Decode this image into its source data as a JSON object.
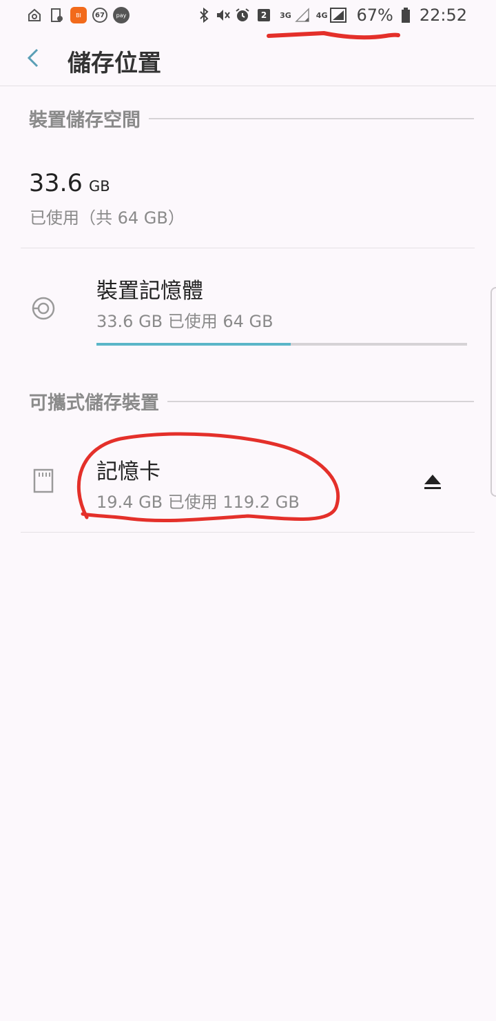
{
  "status_bar": {
    "notif_badge": "BI",
    "circle_num": "67",
    "pay_label": "pay",
    "notif_count": "2",
    "net_3g": "3G",
    "net_4g": "4G",
    "battery": "67%",
    "time": "22:52"
  },
  "header": {
    "title": "儲存位置"
  },
  "device_section": {
    "header": "裝置儲存空間",
    "used_value": "33.6",
    "used_unit": "GB",
    "total_text": "已使用（共 64 GB）",
    "item": {
      "title": "裝置記憶體",
      "subtitle": "33.6 GB 已使用 64 GB",
      "progress": 0.525
    }
  },
  "portable_section": {
    "header": "可攜式儲存裝置",
    "item": {
      "title": "記憶卡",
      "subtitle": "19.4 GB 已使用 119.2 GB"
    }
  },
  "colors": {
    "accent": "#5ab6c8",
    "background": "#fcf8fc",
    "annotation": "#e4302a"
  }
}
